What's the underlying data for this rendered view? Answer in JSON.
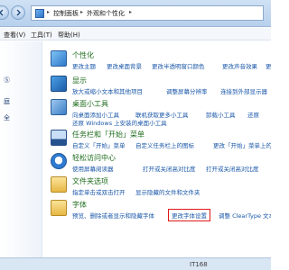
{
  "breadcrumb": {
    "items": [
      "控制面板",
      "外观和个性化"
    ]
  },
  "menubar": {
    "items": [
      "查看(V)",
      "工具(T)",
      "帮助(H)"
    ]
  },
  "sidebar": {
    "items": [
      "Ⓢ",
      "庭",
      "全"
    ]
  },
  "categories": [
    {
      "title": "个性化",
      "icon": "personalization-icon",
      "rows": [
        [
          "更改主题",
          "更改桌面背景",
          "更改半透明窗口颜色",
          "更改声音效果",
          "更"
        ]
      ]
    },
    {
      "title": "显示",
      "icon": "display-icon",
      "rows": [
        [
          "放大或缩小文本和其他项目",
          "调整屏幕分辨率",
          "连接到外部显示器"
        ]
      ]
    },
    {
      "title": "桌面小工具",
      "icon": "gadgets-icon",
      "rows": [
        [
          "向桌面添加小工具",
          "联机获取更多小工具",
          "卸载小工具",
          "还原"
        ],
        [
          "还原 Windows 上安装的桌面小工具"
        ]
      ]
    },
    {
      "title": "任务栏和「开始」菜单",
      "icon": "taskbar-icon",
      "rows": [
        [
          "自定义「开始」菜单",
          "自定义任务栏上的图标",
          "更改「开始」菜单上的图"
        ]
      ]
    },
    {
      "title": "轻松访问中心",
      "icon": "ease-of-access-icon",
      "rows": [
        [
          "使用屏幕阅读器",
          "打开或关闭高对比度",
          "打开或关闭高对比度"
        ]
      ]
    },
    {
      "title": "文件夹选项",
      "icon": "folder-options-icon",
      "rows": [
        [
          "指定单击或双击打开",
          "显示隐藏的文件和文件夹"
        ]
      ]
    },
    {
      "title": "字体",
      "icon": "fonts-icon",
      "rows": [
        [
          "预览、删除或者显示和隐藏字体",
          "更改字体设置",
          "调整 ClearType 文本"
        ]
      ]
    }
  ],
  "highlighted_link": "更改字体设置",
  "statusbar": {
    "text": "IT168"
  }
}
